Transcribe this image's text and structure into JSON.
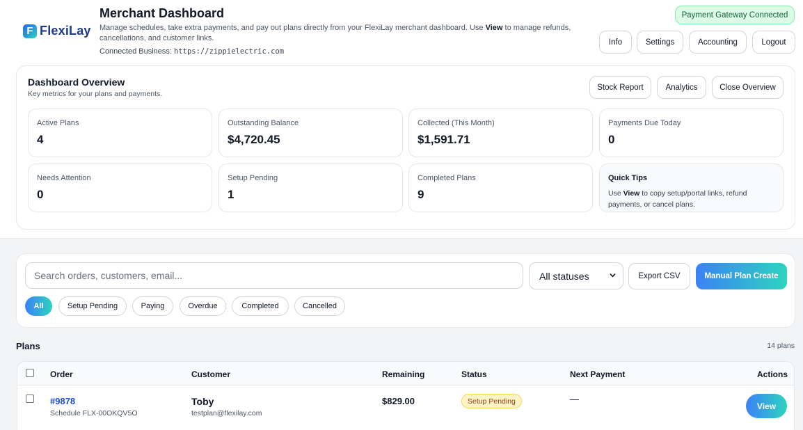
{
  "header": {
    "logo_mark": "F",
    "logo_text": "FlexiLay",
    "title": "Merchant Dashboard",
    "desc_pre": "Manage schedules, take extra payments, and pay out plans directly from your FlexiLay merchant dashboard. Use ",
    "desc_bold": "View",
    "desc_post": " to manage refunds, cancellations, and customer links.",
    "connected_label": "Connected Business: ",
    "connected_url": "https://zippielectric.com",
    "gateway_badge": "Payment Gateway Connected",
    "nav": [
      "Info",
      "Settings",
      "Accounting",
      "Logout"
    ]
  },
  "overview": {
    "title": "Dashboard Overview",
    "subtitle": "Key metrics for your plans and payments.",
    "buttons": [
      "Stock Report",
      "Analytics",
      "Close Overview"
    ],
    "metrics": [
      {
        "label": "Active Plans",
        "value": "4"
      },
      {
        "label": "Outstanding Balance",
        "value": "$4,720.45"
      },
      {
        "label": "Collected (This Month)",
        "value": "$1,591.71"
      },
      {
        "label": "Payments Due Today",
        "value": "0"
      },
      {
        "label": "Needs Attention",
        "value": "0"
      },
      {
        "label": "Setup Pending",
        "value": "1"
      },
      {
        "label": "Completed Plans",
        "value": "9"
      }
    ],
    "tips": {
      "title": "Quick Tips",
      "pre": "Use ",
      "bold": "View",
      "post": " to copy setup/portal links, refund payments, or cancel plans."
    }
  },
  "filters": {
    "search_placeholder": "Search orders, customers, email...",
    "status_selected": "All statuses",
    "export_label": "Export CSV",
    "create_label": "Manual Plan Create",
    "chips": [
      "All",
      "Setup Pending",
      "Paying",
      "Overdue",
      "Completed",
      "Cancelled"
    ]
  },
  "plans": {
    "title": "Plans",
    "count": "14 plans",
    "columns": [
      "Order",
      "Customer",
      "Remaining",
      "Status",
      "Next Payment",
      "Actions"
    ],
    "rows": [
      {
        "order": "#9878",
        "schedule": "Schedule FLX-00OKQV5O",
        "customer": "Toby",
        "email": "testplan@flexilay.com",
        "remaining": "$829.00",
        "status": "Setup Pending",
        "next_payment": "—",
        "action": "View"
      }
    ]
  },
  "colors": {
    "accent_start": "#3b82f6",
    "accent_end": "#2dd4bf",
    "link": "#1d4ed8",
    "success_bg": "#dcfce7",
    "pending_bg": "#fef3c7"
  }
}
